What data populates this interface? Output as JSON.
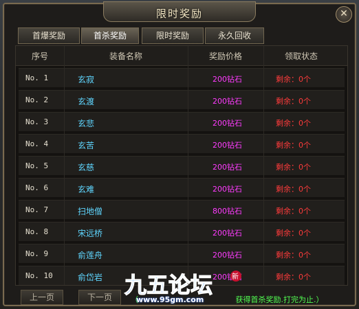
{
  "window": {
    "title": "限时奖励",
    "close_glyph": "✕"
  },
  "tabs": [
    {
      "label": "首爆奖励",
      "active": false
    },
    {
      "label": "首杀奖励",
      "active": true
    },
    {
      "label": "限时奖励",
      "active": false
    },
    {
      "label": "永久回收",
      "active": false
    }
  ],
  "table": {
    "headers": [
      "序号",
      "装备名称",
      "奖励价格",
      "领取状态"
    ],
    "rows": [
      {
        "no": "No.  1",
        "name": "玄寂",
        "price": "200钻石",
        "status": "剩余：0个"
      },
      {
        "no": "No.  2",
        "name": "玄渡",
        "price": "200钻石",
        "status": "剩余：0个"
      },
      {
        "no": "No.  3",
        "name": "玄悲",
        "price": "200钻石",
        "status": "剩余：0个"
      },
      {
        "no": "No.  4",
        "name": "玄苦",
        "price": "200钻石",
        "status": "剩余：0个"
      },
      {
        "no": "No.  5",
        "name": "玄慈",
        "price": "200钻石",
        "status": "剩余：0个"
      },
      {
        "no": "No.  6",
        "name": "玄难",
        "price": "200钻石",
        "status": "剩余：0个"
      },
      {
        "no": "No.  7",
        "name": "扫地僧",
        "price": "800钻石",
        "status": "剩余：0个"
      },
      {
        "no": "No.  8",
        "name": "宋远桥",
        "price": "200钻石",
        "status": "剩余：0个"
      },
      {
        "no": "No.  9",
        "name": "俞莲舟",
        "price": "200钻石",
        "status": "剩余：0个"
      },
      {
        "no": "No. 10",
        "name": "俞岱岩",
        "price": "200钻石",
        "status": "剩余：0个"
      }
    ]
  },
  "pager": {
    "prev_label": "上一页",
    "next_label": "下一页"
  },
  "hint": "获得首杀奖励.打完为止.）",
  "hint_partial": "（",
  "watermark": {
    "brand": "九五论坛",
    "badge": "新",
    "url": "www.95gm.com"
  },
  "colors": {
    "name": "#5fd6ff",
    "price": "#ff3cff",
    "status": "#ff3b3b",
    "hint": "#52ff52"
  }
}
